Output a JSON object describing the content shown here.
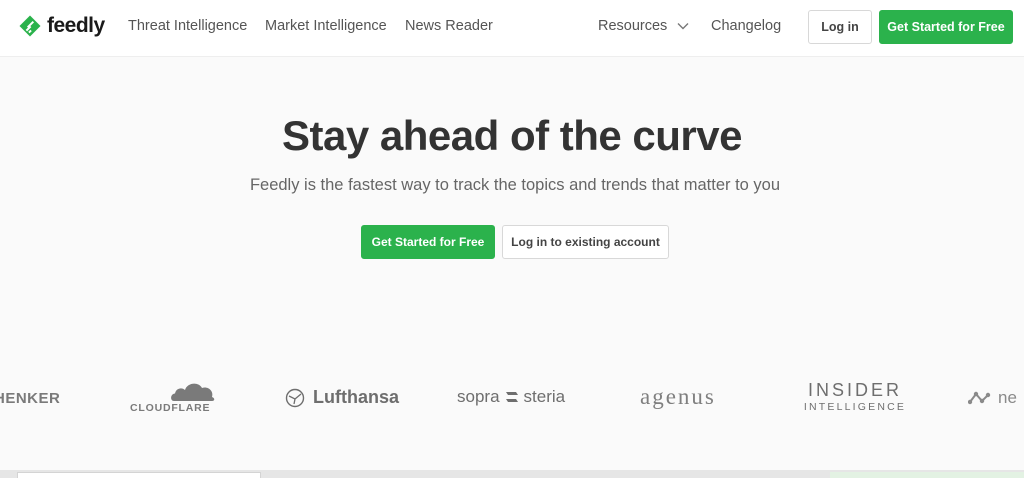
{
  "brand": {
    "name": "feedly",
    "logo_icon": "feedly-leaf-icon",
    "color": "#2bb24c"
  },
  "nav": {
    "links": [
      {
        "label": "Threat Intelligence"
      },
      {
        "label": "Market Intelligence"
      },
      {
        "label": "News Reader"
      }
    ],
    "resources_label": "Resources",
    "resources_icon": "chevron-down-icon",
    "changelog_label": "Changelog",
    "login_label": "Log in",
    "cta_label": "Get Started for Free"
  },
  "hero": {
    "title": "Stay ahead of the curve",
    "subtitle": "Feedly is the fastest way to track the topics and trends that matter to you",
    "primary_cta": "Get Started for Free",
    "secondary_cta": "Log in to existing account"
  },
  "customers": {
    "logos": [
      "HENKER",
      "CLOUDFLARE",
      "Lufthansa",
      "sopra",
      "steria",
      "agenus",
      "INSIDER",
      "INTELLIGENCE",
      "ne"
    ]
  },
  "colors": {
    "accent": "#2bb24c",
    "text": "#333333",
    "muted": "#666666",
    "background": "#fafafa"
  }
}
